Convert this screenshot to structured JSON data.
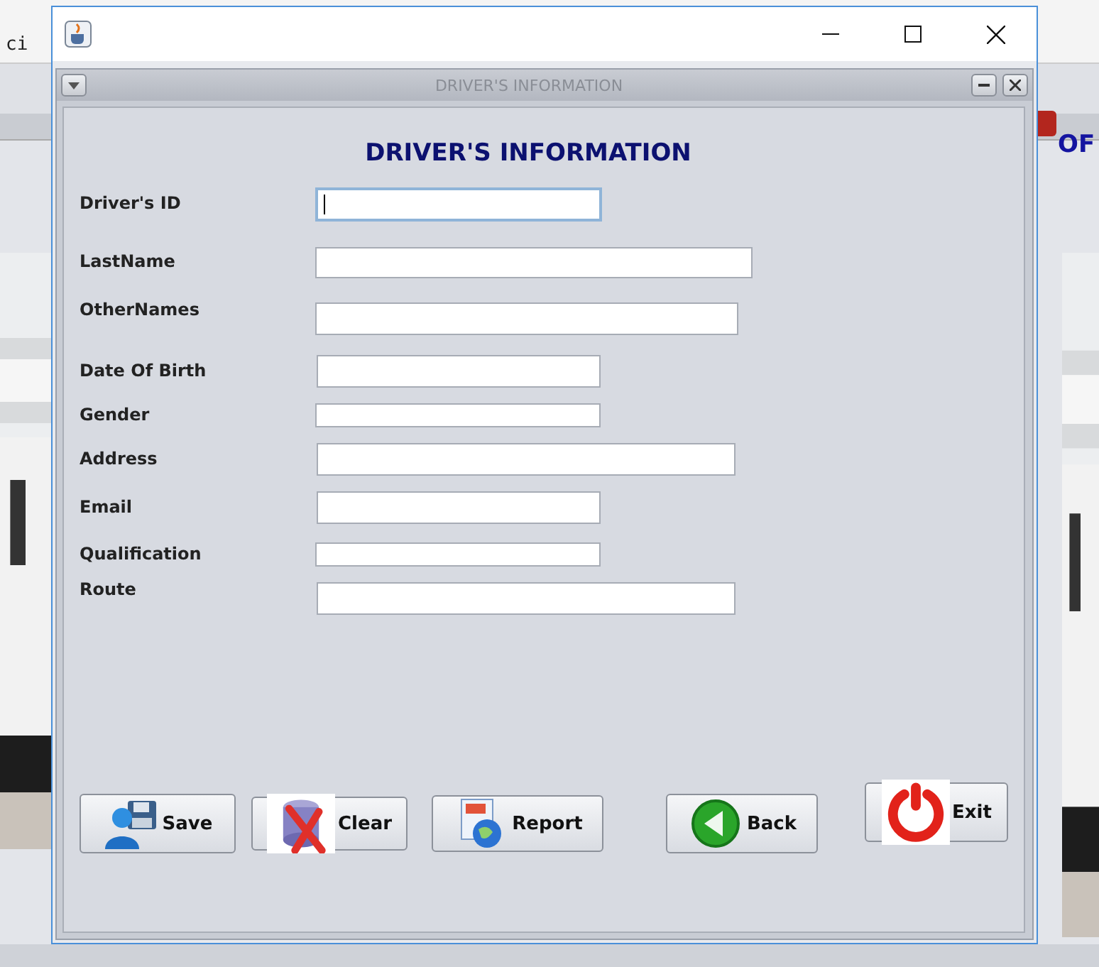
{
  "background_app": {
    "toolbar_text": "ci",
    "heading_fragment": "OF"
  },
  "internal_frame": {
    "title": "DRIVER'S INFORMATION"
  },
  "form": {
    "heading": "DRIVER'S INFORMATION",
    "fields": [
      {
        "label": "Driver's ID",
        "focused": true
      },
      {
        "label": "LastName",
        "focused": false
      },
      {
        "label": "OtherNames",
        "focused": false
      },
      {
        "label": "Date Of Birth",
        "focused": false
      },
      {
        "label": "Gender",
        "focused": false
      },
      {
        "label": "Address",
        "focused": false
      },
      {
        "label": "Email",
        "focused": false
      },
      {
        "label": "Qualification",
        "focused": false
      },
      {
        "label": "Route",
        "focused": false
      }
    ]
  },
  "buttons": [
    {
      "label": "Save",
      "kind": "save"
    },
    {
      "label": "Clear",
      "kind": "clear"
    },
    {
      "label": "Report",
      "kind": "report"
    },
    {
      "label": "Back",
      "kind": "back"
    },
    {
      "label": "Exit",
      "kind": "exit"
    }
  ]
}
